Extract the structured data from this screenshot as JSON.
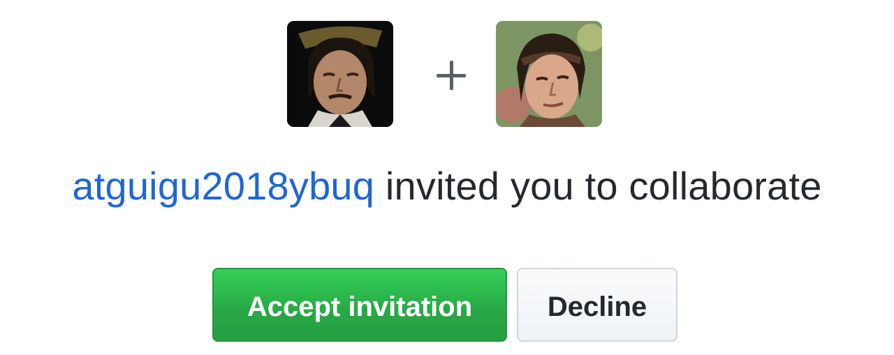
{
  "invitation": {
    "inviter_username": "atguigu2018ybuq",
    "message": " invited you to collaborate",
    "plus_symbol": "+"
  },
  "avatars": {
    "inviter": {
      "alt": "atguigu2018ybuq avatar"
    },
    "invitee": {
      "alt": "your avatar"
    }
  },
  "actions": {
    "accept_label": "Accept invitation",
    "decline_label": "Decline"
  },
  "colors": {
    "link": "#1f66d6",
    "text": "#24292e",
    "accept_bg": "#28a745",
    "decline_bg": "#eff3f6"
  }
}
